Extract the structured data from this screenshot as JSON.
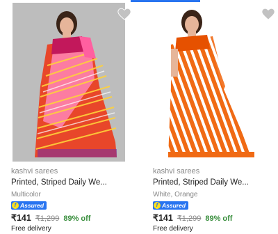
{
  "products": [
    {
      "brand": "kashvi sarees",
      "title": "Printed, Striped Daily We...",
      "variant": "Multicolor",
      "assured_label": "Assured",
      "assured_icon": "f",
      "price": "₹141",
      "mrp": "₹1,299",
      "discount": "89% off",
      "delivery": "Free delivery",
      "image_icon": "saree-model-image",
      "colors": {
        "saree_primary": "#e8462a",
        "saree_secondary": "#ff86b6",
        "background": "#bdbdbd"
      }
    },
    {
      "brand": "kashvi sarees",
      "title": "Printed, Striped Daily We...",
      "variant": "White, Orange",
      "assured_label": "Assured",
      "assured_icon": "f",
      "price": "₹141",
      "mrp": "₹1,299",
      "discount": "89% off",
      "delivery": "Free delivery",
      "image_icon": "saree-model-image",
      "colors": {
        "saree_primary": "#f06a14",
        "saree_secondary": "#ffffff",
        "background": "#ffffff"
      }
    }
  ],
  "theme": {
    "accent": "#2874f0",
    "discount_green": "#388e3c",
    "muted": "#878787"
  }
}
